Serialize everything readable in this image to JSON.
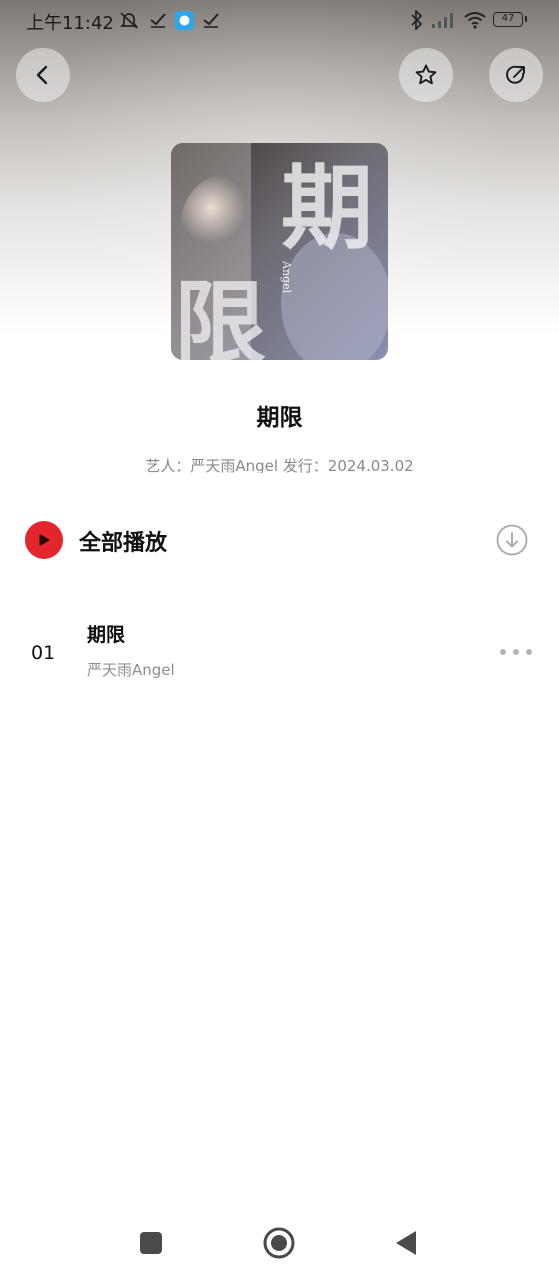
{
  "status_bar": {
    "time": "上午11:42",
    "battery": "47",
    "icons": [
      "mute-bell-icon",
      "check-icon",
      "app-notification-icon",
      "check-icon",
      "bluetooth-icon",
      "signal-icon",
      "wifi-icon",
      "battery-icon"
    ]
  },
  "header": {
    "back_icon": "chevron-left-icon",
    "favorite_icon": "star-icon",
    "share_icon": "share-icon"
  },
  "album": {
    "cover_text_main": "期",
    "cover_text_second": "限",
    "cover_text_vertical": "Angel",
    "title": "期限",
    "meta": "艺人：严天雨Angel 发行：2024.03.02"
  },
  "play_all": {
    "label": "全部播放",
    "play_icon": "play-icon",
    "download_icon": "download-icon"
  },
  "tracks": [
    {
      "number": "01",
      "title": "期限",
      "artist": "严天雨Angel"
    }
  ],
  "nav_bar": {
    "items": [
      "recents-square-icon",
      "home-circle-icon",
      "back-triangle-icon"
    ]
  },
  "colors": {
    "accent": "#e4252b",
    "text_primary": "#111111",
    "text_secondary": "#8a8a8a"
  }
}
